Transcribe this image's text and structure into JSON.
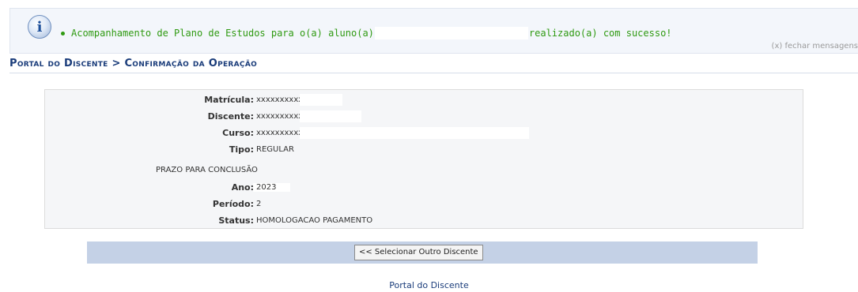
{
  "message": {
    "icon": "info-icon",
    "text_before": "Acompanhamento de Plano de Estudos para o(a) aluno(a)",
    "text_after": "realizado(a) com sucesso!",
    "close_label": "(x) fechar mensagens",
    "color": "#2f9a12"
  },
  "page_title": "Portal do Discente > Confirmação da Operação",
  "details": {
    "matricula_label": "Matrícula:",
    "matricula_value": "xxxxxxxxxxxxxxx",
    "discente_label": "Discente:",
    "discente_value": "xxxxxxxxxxxxxxx",
    "curso_label": "Curso:",
    "curso_value": "xxxxxxxxxxxxxxx",
    "tipo_label": "Tipo:",
    "tipo_value": "REGULAR",
    "prazo_section": "PRAZO PARA CONCLUSÃO",
    "ano_label": "Ano:",
    "ano_value": "2023",
    "periodo_label": "Período:",
    "periodo_value": "2",
    "status_label": "Status:",
    "status_value": "HOMOLOGACAO PAGAMENTO"
  },
  "actions": {
    "select_other_label": "<< Selecionar Outro Discente"
  },
  "footer_link": "Portal do Discente",
  "colors": {
    "title": "#1a3c7a",
    "action_bar": "#c4d1e6"
  }
}
